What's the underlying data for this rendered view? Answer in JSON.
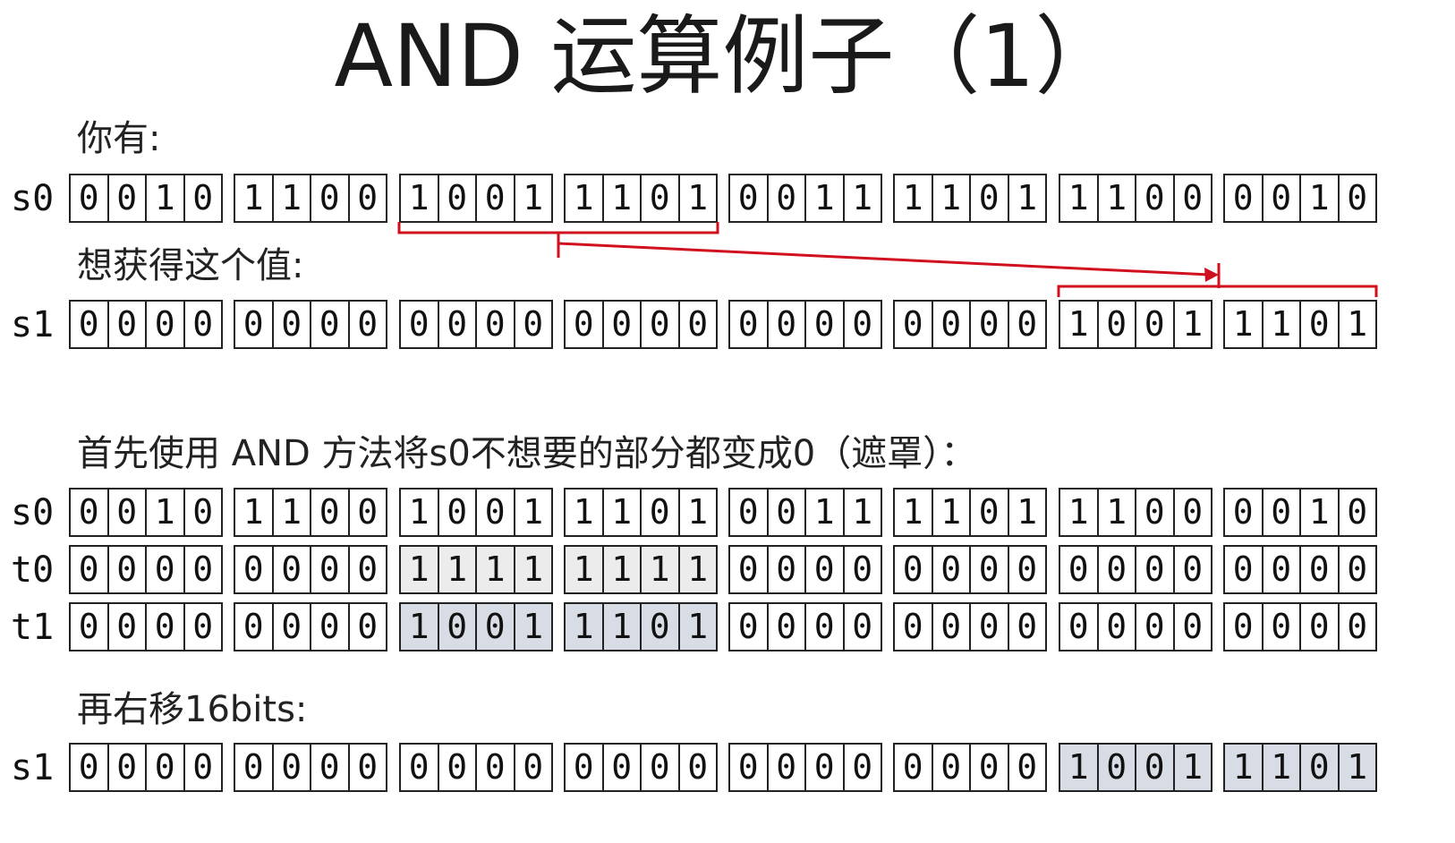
{
  "title": "AND 运算例子（1）",
  "sections": {
    "have_label": "你有:",
    "want_label": "想获得这个值:",
    "mask_label": "首先使用 AND 方法将s0不想要的部分都变成0（遮罩）：",
    "shift_label": "再右移16bits:"
  },
  "rows": [
    {
      "name": "s0",
      "groups": [
        "0010",
        "1100",
        "1001",
        "1101",
        "0011",
        "1101",
        "1100",
        "0010"
      ],
      "shade": [
        0,
        0,
        0,
        0,
        0,
        0,
        0,
        0
      ]
    },
    {
      "name": "s1",
      "groups": [
        "0000",
        "0000",
        "0000",
        "0000",
        "0000",
        "0000",
        "1001",
        "1101"
      ],
      "shade": [
        0,
        0,
        0,
        0,
        0,
        0,
        0,
        0
      ]
    },
    {
      "name": "s0",
      "groups": [
        "0010",
        "1100",
        "1001",
        "1101",
        "0011",
        "1101",
        "1100",
        "0010"
      ],
      "shade": [
        0,
        0,
        0,
        0,
        0,
        0,
        0,
        0
      ]
    },
    {
      "name": "t0",
      "groups": [
        "0000",
        "0000",
        "1111",
        "1111",
        "0000",
        "0000",
        "0000",
        "0000"
      ],
      "shade": [
        0,
        0,
        1,
        1,
        0,
        0,
        0,
        0
      ]
    },
    {
      "name": "t1",
      "groups": [
        "0000",
        "0000",
        "1001",
        "1101",
        "0000",
        "0000",
        "0000",
        "0000"
      ],
      "shade": [
        0,
        0,
        2,
        2,
        0,
        0,
        0,
        0
      ]
    },
    {
      "name": "s1",
      "groups": [
        "0000",
        "0000",
        "0000",
        "0000",
        "0000",
        "0000",
        "1001",
        "1101"
      ],
      "shade": [
        0,
        0,
        0,
        0,
        0,
        0,
        2,
        2
      ]
    }
  ],
  "colors": {
    "bracket": "#d0101e",
    "mask_fill": "#ececec",
    "result_fill": "#d8dde5"
  }
}
